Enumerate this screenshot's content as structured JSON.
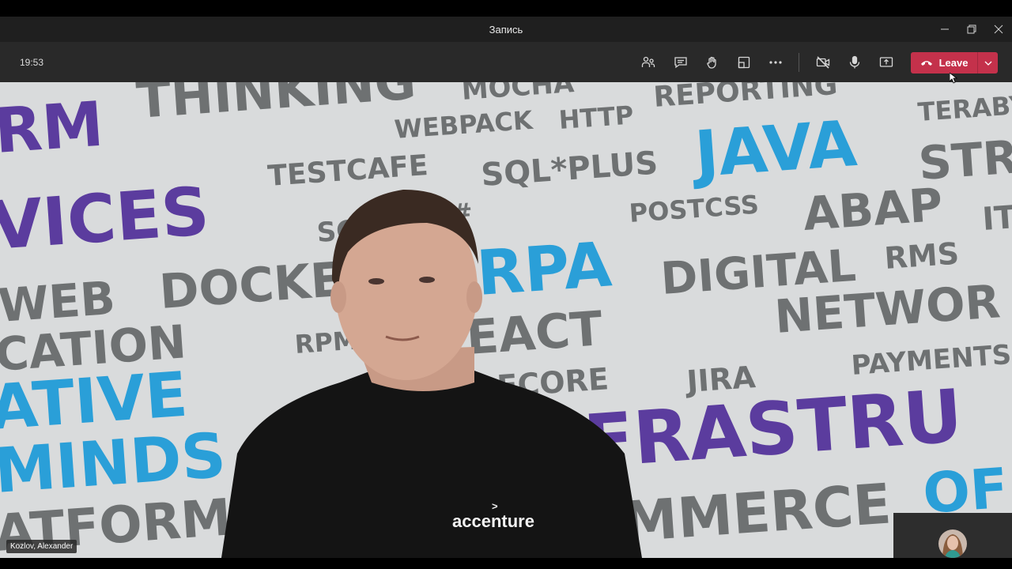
{
  "window": {
    "title": "Запись",
    "controls": {
      "minimize": "minimize-icon",
      "restore": "restore-icon",
      "close": "close-icon"
    }
  },
  "toolbar": {
    "timer": "19:53",
    "icons": [
      "people-icon",
      "chat-icon",
      "raise-hand-icon",
      "breakout-icon",
      "more-icon",
      "camera-off-icon",
      "mic-icon",
      "share-screen-icon"
    ],
    "leave_label": "Leave"
  },
  "video": {
    "participant_name": "Kozlov, Alexander",
    "shirt_logo": "accenture",
    "wall_words": [
      "THINKING",
      "MOCHA",
      "REPORTING",
      "RM",
      "WEBPACK",
      "HTTP",
      "TERABY",
      "JAVA",
      "STR",
      "TESTCAFE",
      "SQL*PLUS",
      "VICES",
      "POSTCSS",
      "ABAP",
      "SC",
      "#",
      "IT",
      "RPA",
      "RMS",
      "WEB",
      "DOCKE",
      "DIGITAL",
      "NETWOR",
      "CATION",
      "RPM",
      "EACT",
      "PAYMENTS",
      "JIRA",
      "ECORE",
      "ATIVE",
      "MINDS",
      "FRASTRU",
      "ATFORM",
      "MMERCE",
      "OF"
    ]
  },
  "colors": {
    "accent_red": "#c4314b",
    "wall_purple": "#5b3c9e",
    "wall_blue": "#2a9fd8",
    "wall_gray": "#6e7172"
  }
}
